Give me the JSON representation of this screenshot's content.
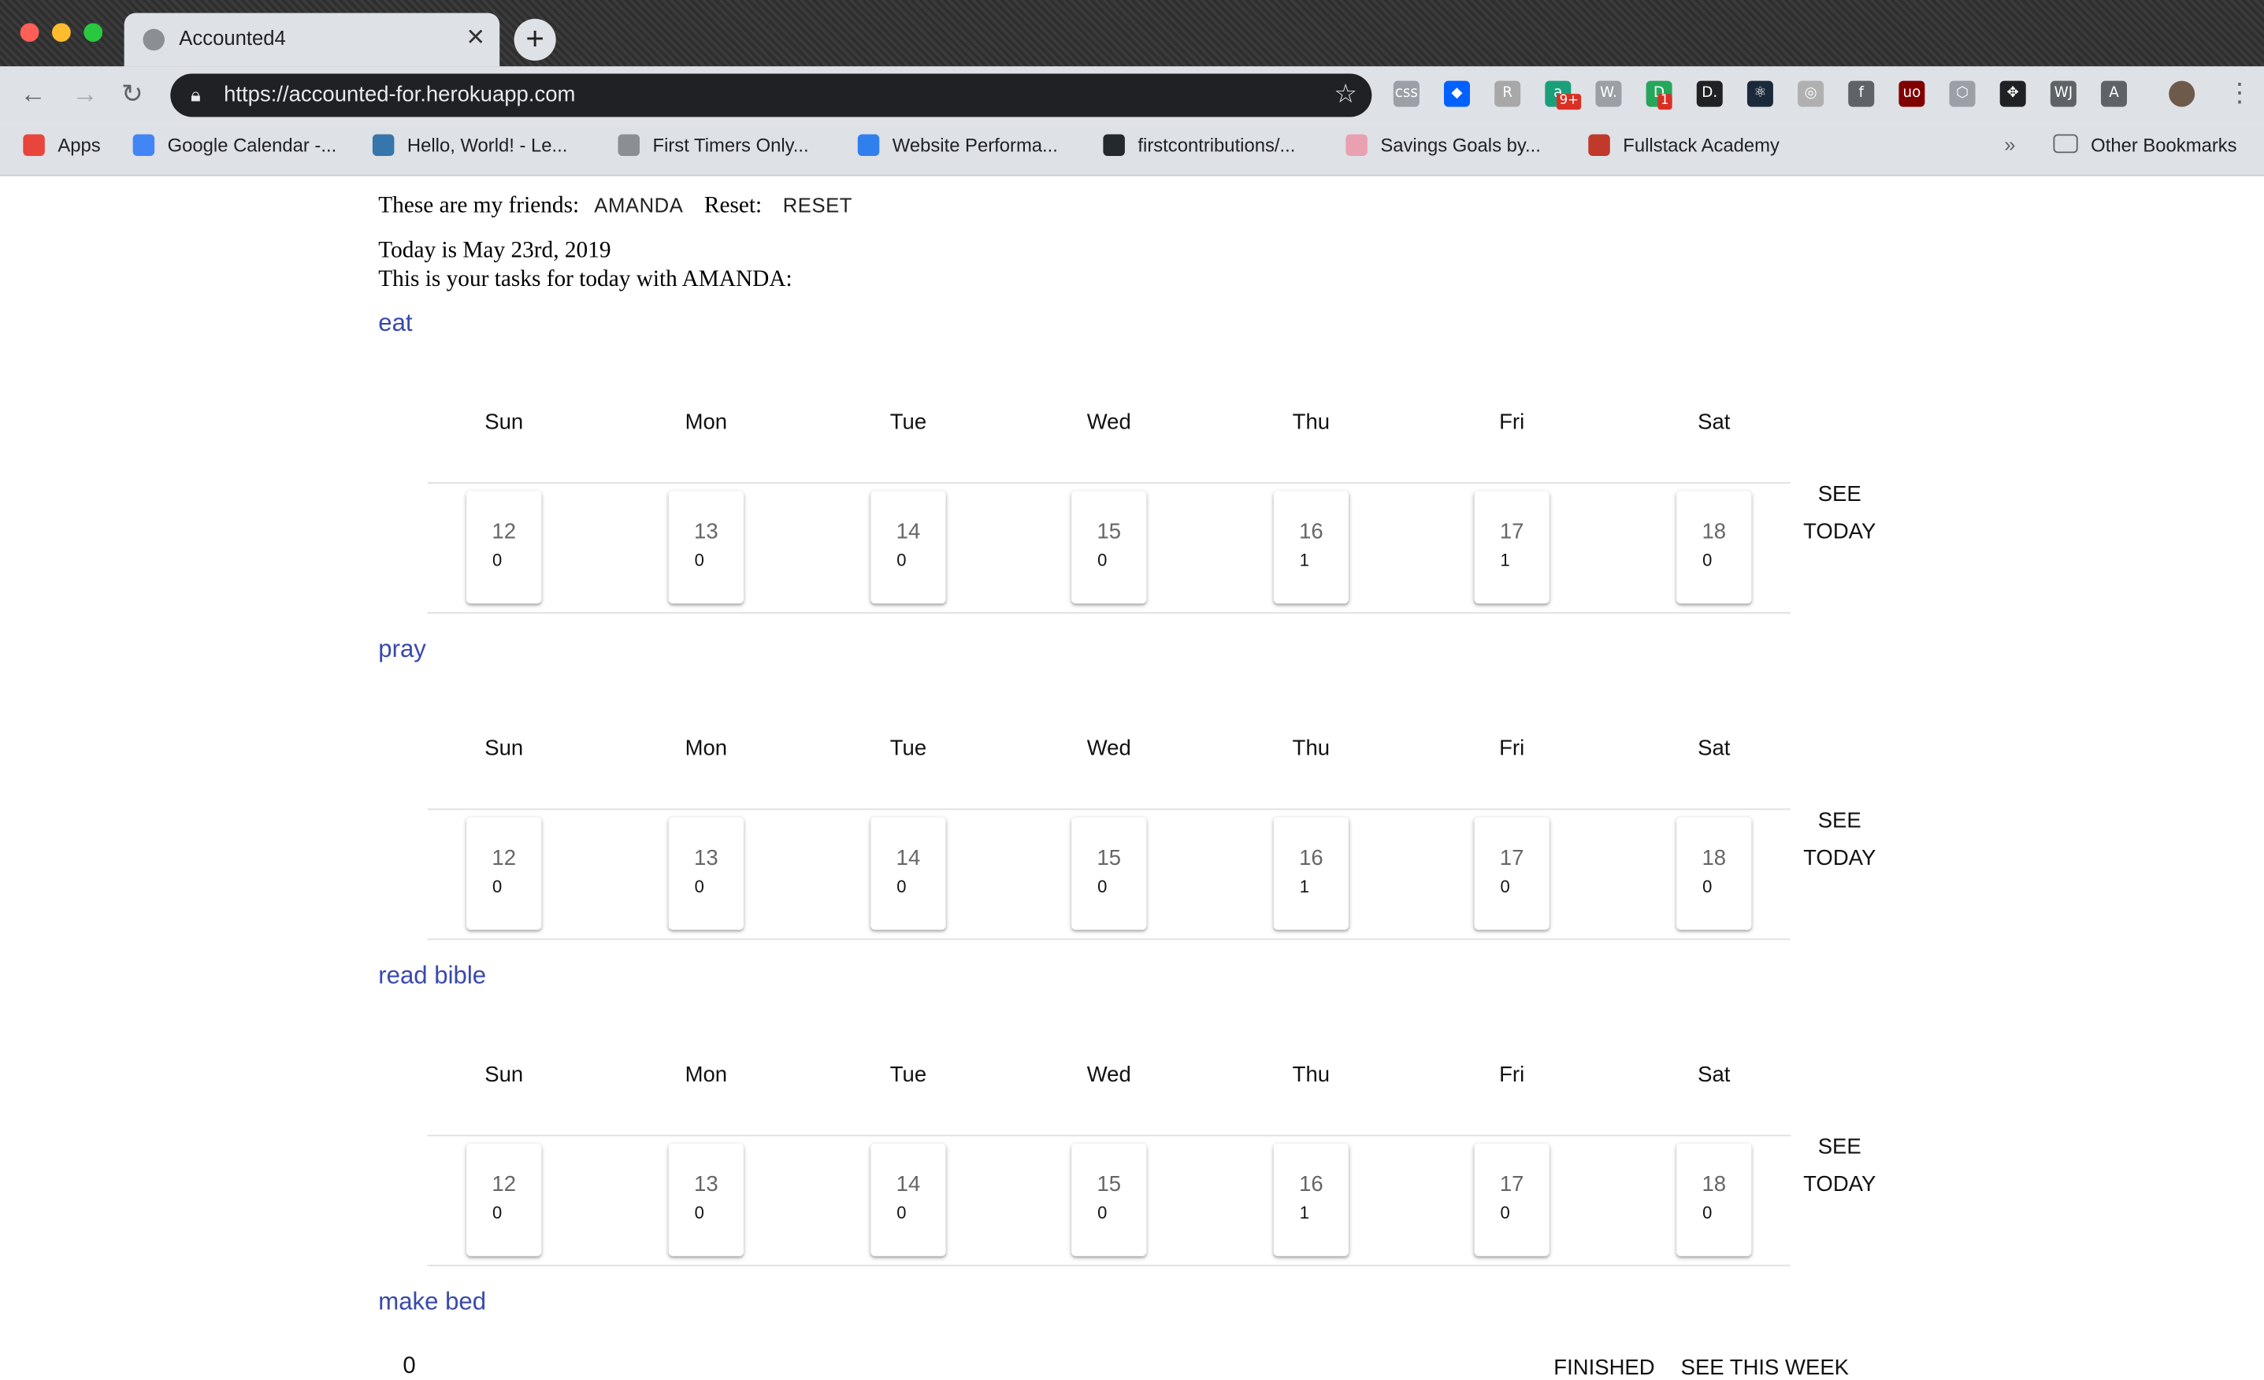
{
  "browser": {
    "tab_title": "Accounted4",
    "url": "https://accounted-for.herokuapp.com",
    "bookmarks": [
      {
        "label": "Apps",
        "color": "#e8453c"
      },
      {
        "label": "Google Calendar -...",
        "color": "#4285f4"
      },
      {
        "label": "Hello, World! - Le...",
        "color": "#3776ab"
      },
      {
        "label": "First Timers Only...",
        "color": "#8b8f94"
      },
      {
        "label": "Website Performa...",
        "color": "#2f80ed"
      },
      {
        "label": "firstcontributions/...",
        "color": "#24292e"
      },
      {
        "label": "Savings Goals by...",
        "color": "#e9a0b0"
      },
      {
        "label": "Fullstack Academy",
        "color": "#c0392b"
      }
    ],
    "other_bookmarks": "Other Bookmarks",
    "extensions": [
      {
        "name": "css-icon",
        "text": "css",
        "color": "#9aa0a6"
      },
      {
        "name": "dropbox-icon",
        "text": "◆",
        "color": "#0061fe"
      },
      {
        "name": "extension-r-icon",
        "text": "R",
        "color": "#a8a8a8"
      },
      {
        "name": "extension-badge-icon",
        "text": "a",
        "color": "#1a9f7a",
        "badge": "9+"
      },
      {
        "name": "extension-w-icon",
        "text": "W.",
        "color": "#9aa0a6"
      },
      {
        "name": "extension-green-icon",
        "text": "D",
        "color": "#26a65b",
        "badge": "1"
      },
      {
        "name": "extension-d-icon",
        "text": "D.",
        "color": "#202124"
      },
      {
        "name": "react-devtools-icon",
        "text": "⚛",
        "color": "#1b2a3a"
      },
      {
        "name": "extension-circle-icon",
        "text": "◎",
        "color": "#b0b0b0"
      },
      {
        "name": "facebook-icon",
        "text": "f",
        "color": "#5f6368"
      },
      {
        "name": "ublock-icon",
        "text": "uo",
        "color": "#800000"
      },
      {
        "name": "extension-hex-icon",
        "text": "⬡",
        "color": "#9aa0a6"
      },
      {
        "name": "extension-move-icon",
        "text": "✥",
        "color": "#202124"
      },
      {
        "name": "wj-icon",
        "text": "WJ",
        "color": "#5f6368"
      },
      {
        "name": "extension-a-icon",
        "text": "A",
        "color": "#5f6368"
      }
    ]
  },
  "header": {
    "friends_label": "These are my friends:",
    "friend_name": "AMANDA",
    "reset_label": "Reset:",
    "reset_button": "RESET",
    "today_text": "Today is May 23rd, 2019",
    "tasks_text": "This is your tasks for today with AMANDA:"
  },
  "day_names": [
    "Sun",
    "Mon",
    "Tue",
    "Wed",
    "Thu",
    "Fri",
    "Sat"
  ],
  "see_today_label": "SEE TODAY",
  "tasks": [
    {
      "title": "eat",
      "days": [
        {
          "date": "12",
          "count": "0"
        },
        {
          "date": "13",
          "count": "0"
        },
        {
          "date": "14",
          "count": "0"
        },
        {
          "date": "15",
          "count": "0"
        },
        {
          "date": "16",
          "count": "1"
        },
        {
          "date": "17",
          "count": "1"
        },
        {
          "date": "18",
          "count": "0"
        }
      ]
    },
    {
      "title": "pray",
      "days": [
        {
          "date": "12",
          "count": "0"
        },
        {
          "date": "13",
          "count": "0"
        },
        {
          "date": "14",
          "count": "0"
        },
        {
          "date": "15",
          "count": "0"
        },
        {
          "date": "16",
          "count": "1"
        },
        {
          "date": "17",
          "count": "0"
        },
        {
          "date": "18",
          "count": "0"
        }
      ]
    },
    {
      "title": "read bible",
      "days": [
        {
          "date": "12",
          "count": "0"
        },
        {
          "date": "13",
          "count": "0"
        },
        {
          "date": "14",
          "count": "0"
        },
        {
          "date": "15",
          "count": "0"
        },
        {
          "date": "16",
          "count": "1"
        },
        {
          "date": "17",
          "count": "0"
        },
        {
          "date": "18",
          "count": "0"
        }
      ]
    },
    {
      "title": "make bed"
    }
  ],
  "footer": {
    "count": "0",
    "finished_button": "FINISHED",
    "see_week_button": "SEE THIS WEEK"
  }
}
